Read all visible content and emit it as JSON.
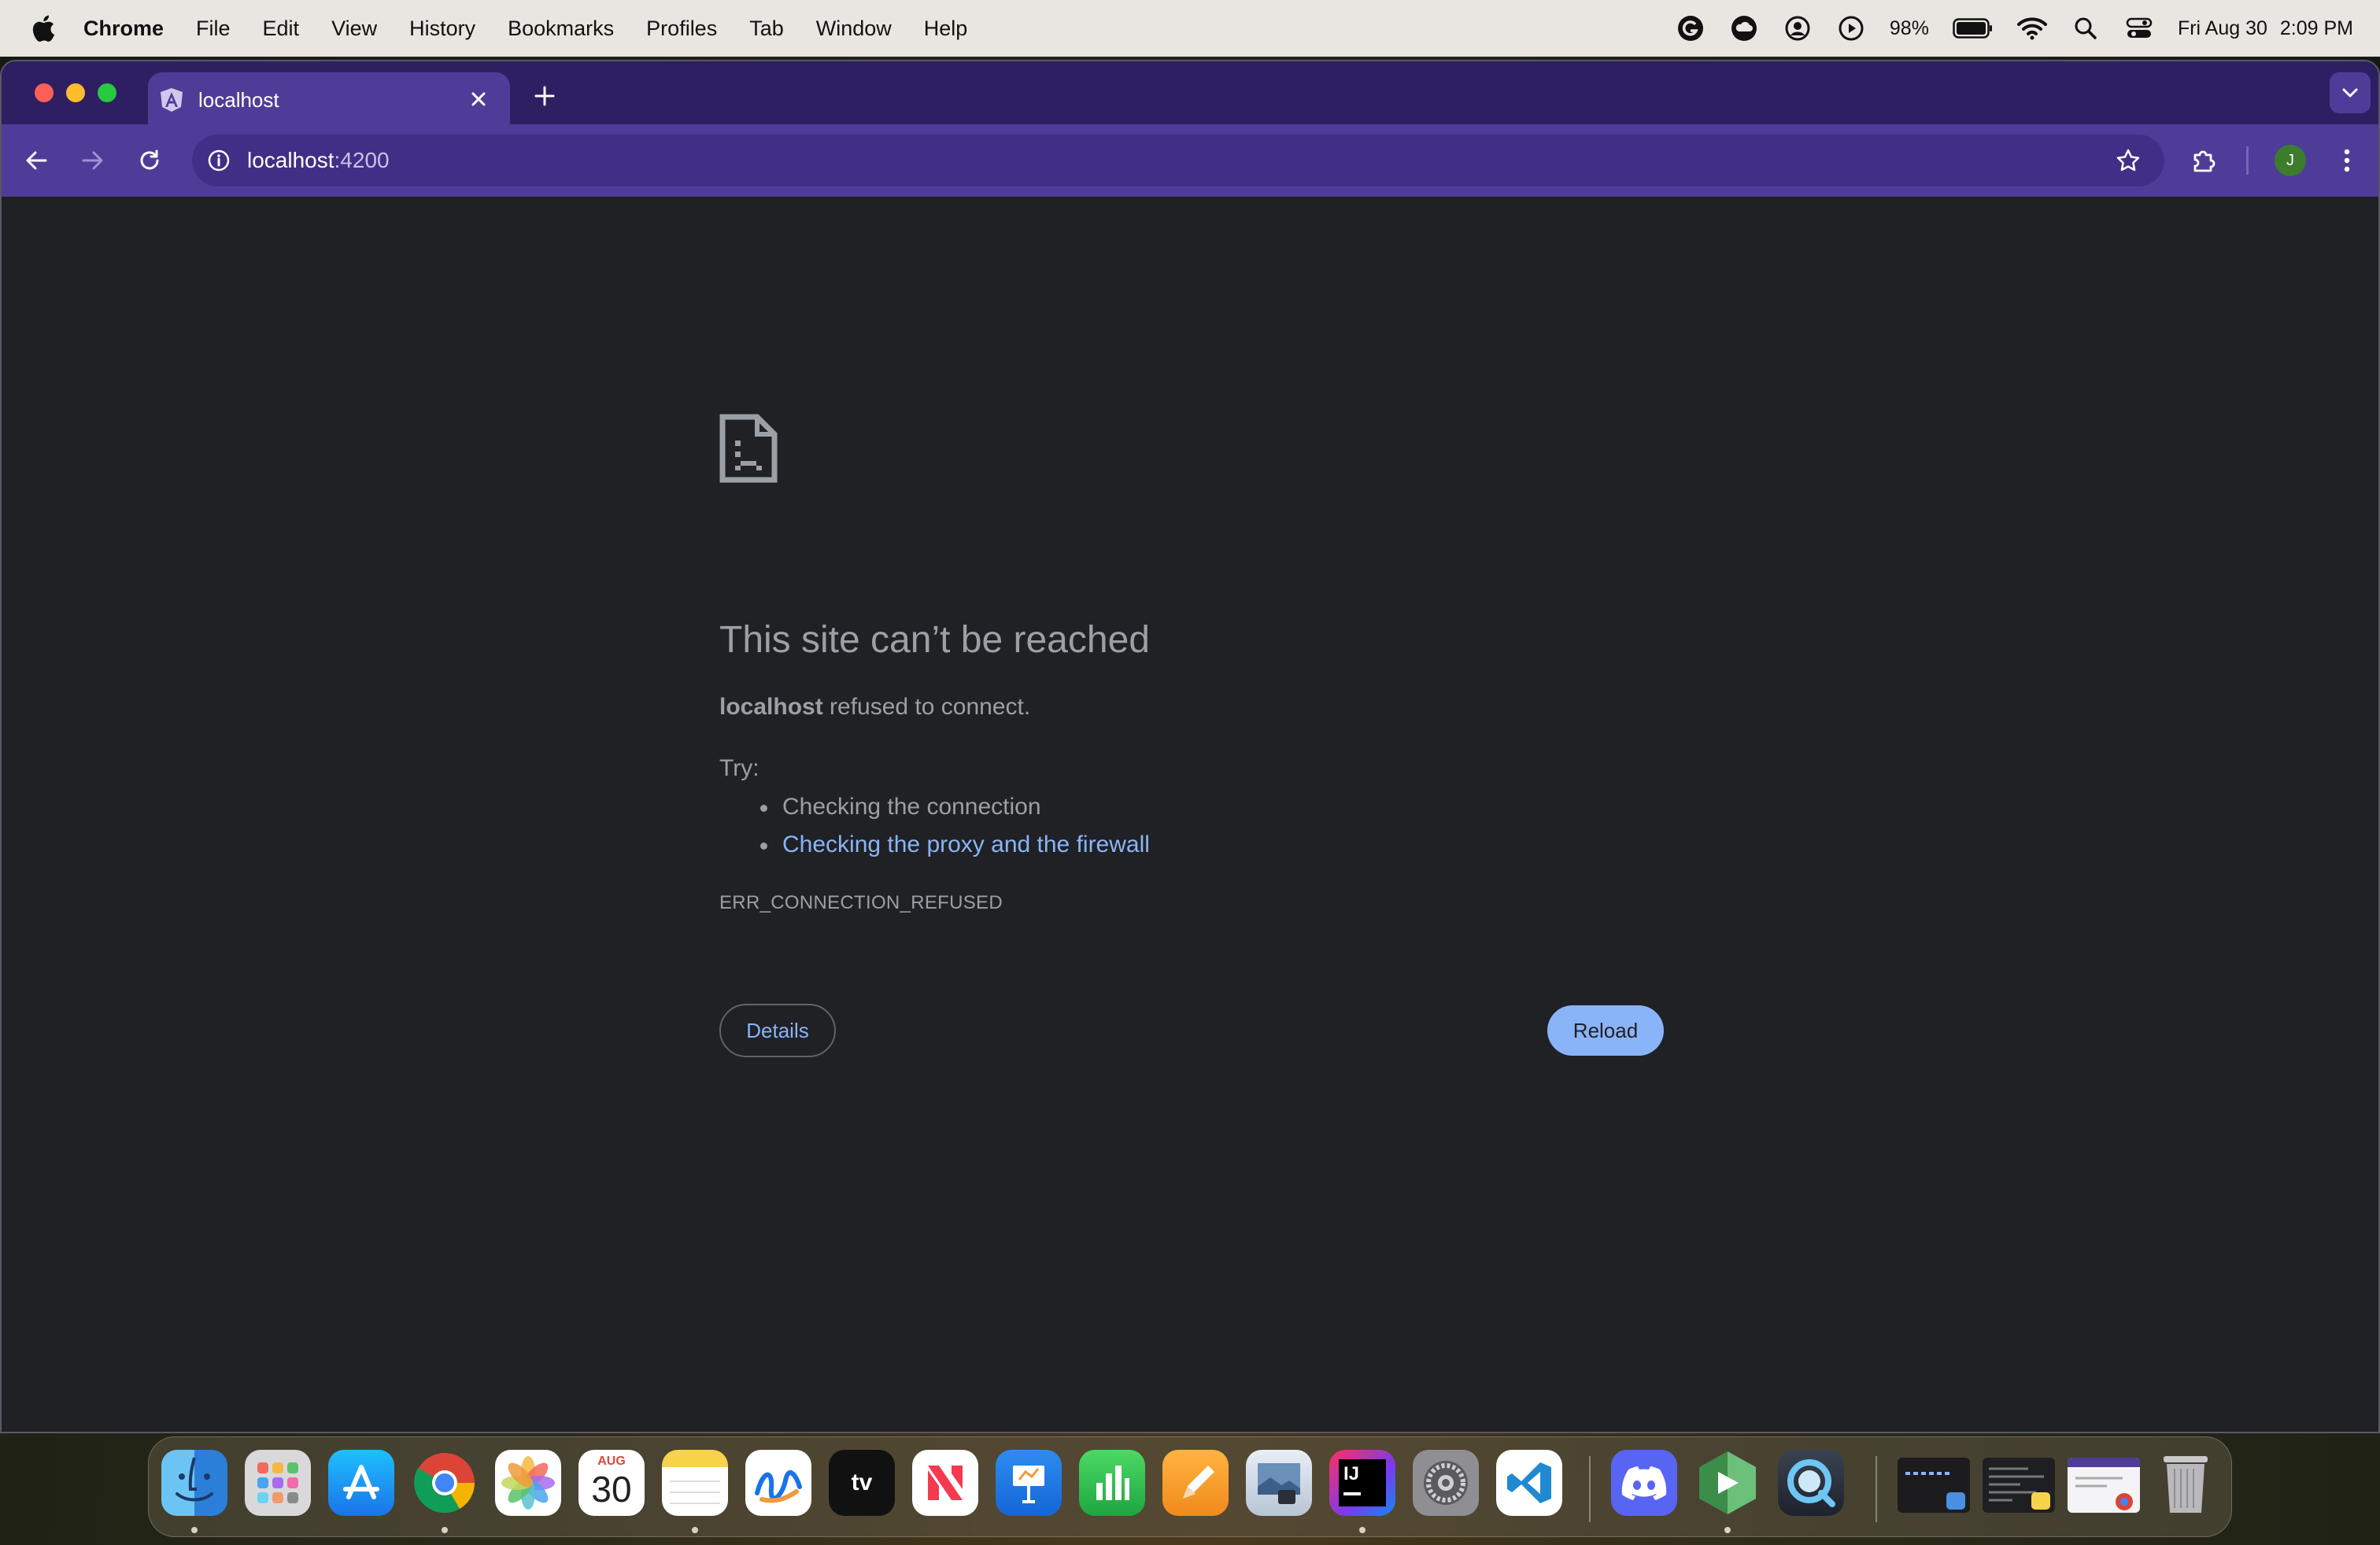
{
  "menubar": {
    "app_name": "Chrome",
    "items": [
      "File",
      "Edit",
      "View",
      "History",
      "Bookmarks",
      "Profiles",
      "Tab",
      "Window",
      "Help"
    ],
    "battery": "98%",
    "date": "Fri Aug 30",
    "time": "2:09 PM"
  },
  "browser": {
    "tab_title": "localhost",
    "url_host": "localhost",
    "url_port": ":4200",
    "profile_initial": "J",
    "accent_color": "#4f3c98",
    "tabstrip_color": "#2e1f62"
  },
  "error_page": {
    "title": "This site can’t be reached",
    "host": "localhost",
    "message": " refused to connect.",
    "try_label": "Try:",
    "suggestions": [
      "Checking the connection",
      "Checking the proxy and the firewall"
    ],
    "error_code": "ERR_CONNECTION_REFUSED",
    "details_label": "Details",
    "reload_label": "Reload"
  },
  "dock": {
    "calendar_month": "AUG",
    "calendar_day": "30",
    "tv_label": "tv",
    "intellij_label": "IJ",
    "apps": [
      "finder",
      "launchpad",
      "app-store",
      "chrome",
      "photos",
      "calendar",
      "notes",
      "freeform",
      "apple-tv",
      "news",
      "keynote",
      "numbers",
      "pages",
      "preview",
      "intellij",
      "system-settings",
      "vscode",
      "discord",
      "android-studio",
      "quicktime",
      "window-1",
      "window-2",
      "window-3",
      "trash"
    ]
  }
}
